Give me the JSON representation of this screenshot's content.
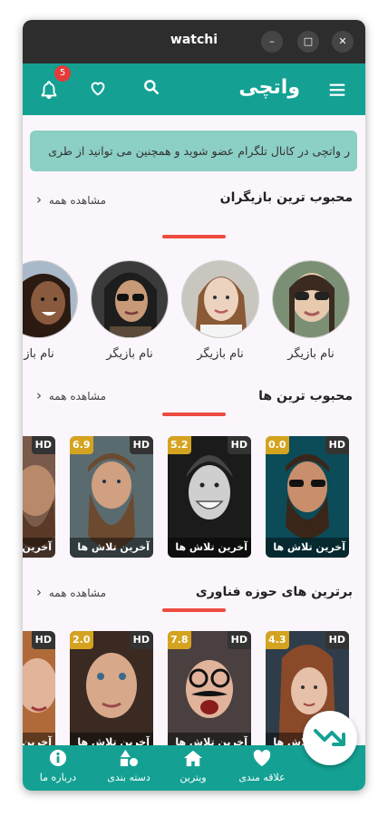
{
  "window": {
    "title": "watchi"
  },
  "appbar": {
    "brand": "واتچی",
    "notification_count": "5"
  },
  "banner": {
    "text": "ر واتچی در کانال تلگرام عضو شوید و همچنین می توانید از طری"
  },
  "sections": {
    "actors": {
      "title": "محبوب ترین بازیگران",
      "see_all": "مشاهده همه"
    },
    "popular": {
      "title": "محبوب ترین ها",
      "see_all": "مشاهده همه"
    },
    "tech": {
      "title": "برترین های حوزه فناوری",
      "see_all": "مشاهده همه"
    }
  },
  "actors": [
    {
      "name": "نام بازیگر"
    },
    {
      "name": "نام بازیگر"
    },
    {
      "name": "نام بازیگر"
    },
    {
      "name": "نام باز"
    }
  ],
  "popular_cards": [
    {
      "rating": "0.0",
      "hd": "HD",
      "caption": "آخرین تلاش ها"
    },
    {
      "rating": "5.2",
      "hd": "HD",
      "caption": "آخرین تلاش ها"
    },
    {
      "rating": "6.9",
      "hd": "HD",
      "caption": "آخرین تلاش ها"
    },
    {
      "rating": "",
      "hd": "HD",
      "caption": "آخرین"
    }
  ],
  "tech_cards": [
    {
      "rating": "4.3",
      "hd": "HD",
      "caption": "آخرین تلاش ها"
    },
    {
      "rating": "7.8",
      "hd": "HD",
      "caption": "آخرین تلاش ها"
    },
    {
      "rating": "2.0",
      "hd": "HD",
      "caption": "آخرین تلاش ها"
    },
    {
      "rating": "",
      "hd": "HD",
      "caption": "آخرین"
    }
  ],
  "bottom_nav": {
    "favorites": "علاقه مندی",
    "showcase": "ویترین",
    "categories": "دسته بندی",
    "about": "درباره ما"
  },
  "colors": {
    "primary": "#14a194",
    "accent": "#ee4a3f",
    "rating": "#d4a320"
  }
}
